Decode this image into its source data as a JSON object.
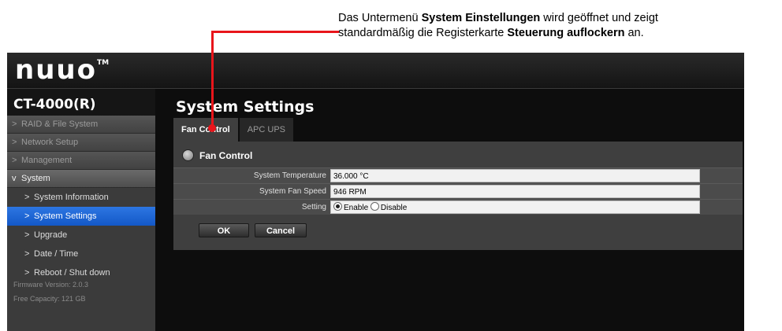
{
  "annotation": {
    "line1_pre": "Das Untermenü ",
    "line1_bold": "System Einstellungen",
    "line1_post": " wird geöffnet und zeigt",
    "line2_pre": "standardmäßig die Registerkarte ",
    "line2_bold": "Steuerung auflockern",
    "line2_post": " an.",
    "callout_color": "#e8151b"
  },
  "header": {
    "logo": "nuuo",
    "logo_tm": "TM"
  },
  "sidebar": {
    "model": "CT-4000(R)",
    "items": [
      {
        "label": "RAID & File System",
        "chevron": ">",
        "expanded": false
      },
      {
        "label": "Network Setup",
        "chevron": ">",
        "expanded": false
      },
      {
        "label": "Management",
        "chevron": ">",
        "expanded": false
      },
      {
        "label": "System",
        "chevron": "v",
        "expanded": true
      }
    ],
    "subitems": [
      {
        "label": "System Information",
        "chevron": ">"
      },
      {
        "label": "System Settings",
        "chevron": ">",
        "active": true
      },
      {
        "label": "Upgrade",
        "chevron": ">"
      },
      {
        "label": "Date / Time",
        "chevron": ">"
      },
      {
        "label": "Reboot / Shut down",
        "chevron": ">"
      }
    ],
    "firmware": "Firmware Version: 2.0.3",
    "capacity": "Free Capacity: 121 GB"
  },
  "main": {
    "title": "System Settings",
    "tabs": [
      {
        "label": "Fan Control",
        "active": true
      },
      {
        "label": "APC UPS",
        "active": false
      }
    ],
    "section_title": "Fan Control",
    "rows": [
      {
        "label": "System Temperature",
        "value": "36.000 °C"
      },
      {
        "label": "System Fan Speed",
        "value": "946 RPM"
      },
      {
        "label": "Setting",
        "options": [
          "Enable",
          "Disable"
        ],
        "selected": "Enable"
      }
    ],
    "ok_label": "OK",
    "cancel_label": "Cancel"
  },
  "colors": {
    "active_nav": "#1d66d6",
    "panel": "#3f3f3f",
    "background": "#0d0d0d"
  }
}
